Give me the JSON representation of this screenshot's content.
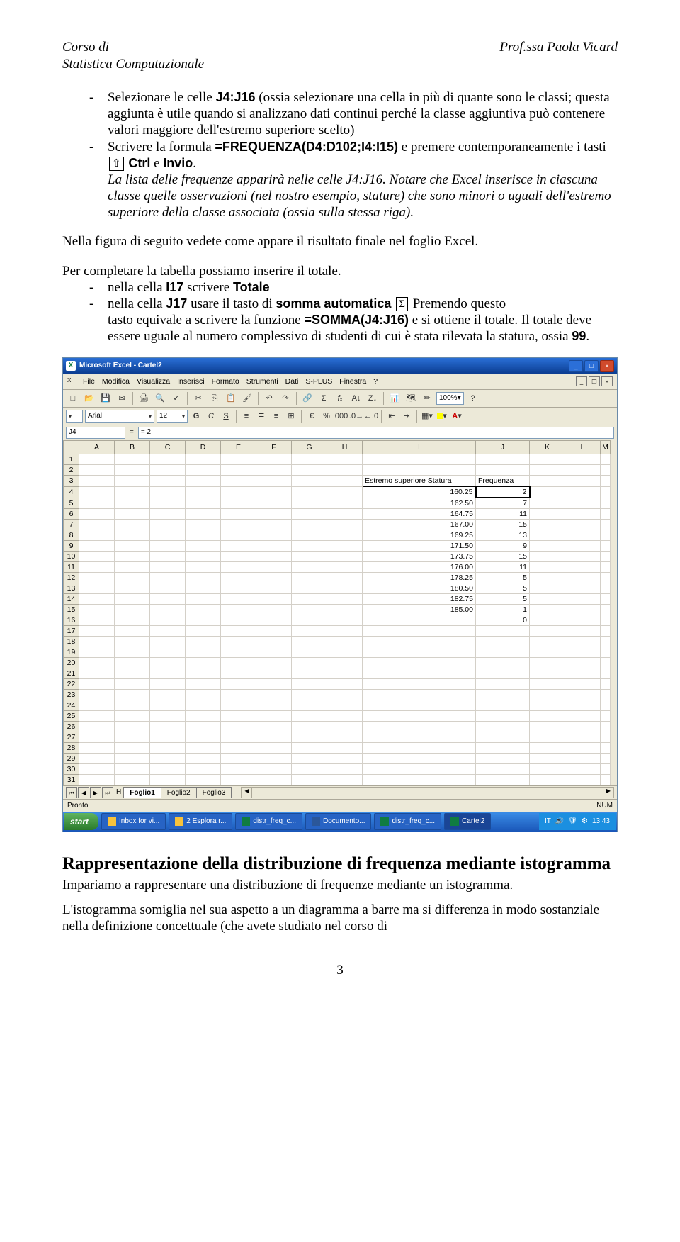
{
  "header": {
    "left_1": "Corso di",
    "right": "Prof.ssa Paola Vicard",
    "left_2": "Statistica Computazionale"
  },
  "li1_a": "Selezionare le celle ",
  "li1_cells": "J4:J16",
  "li1_b": " (ossia selezionare una cella in più di quante sono le classi; questa aggiunta è utile quando si analizzano dati continui perché la classe aggiuntiva può contenere valori maggiore dell'estremo superiore scelto)",
  "li2_a": "Scrivere la formula ",
  "li2_formula": "=FREQUENZA(D4:D102;I4:I15)",
  "li2_b": " e premere contemporaneamente i tasti ",
  "li2_key": "⇧",
  "li2_c": " ",
  "li2_ctrl": "Ctrl",
  "li2_d": " e ",
  "li2_invio": "Invio",
  "li2_e": ".",
  "li2_it": "La lista delle frequenze apparirà nelle celle J4:J16. Notare che Excel inserisce in ciascuna classe quelle osservazioni (nel nostro esempio, stature) che sono minori o uguali dell'estremo superiore della classe associata (ossia sulla stessa riga).",
  "p1": "Nella figura di seguito vedete come appare il risultato finale nel foglio Excel.",
  "p2": "Per completare la tabella possiamo inserire il totale.",
  "li3_a": "nella cella ",
  "li3_cell": "I17",
  "li3_b": " scrivere ",
  "li3_tot": "Totale",
  "li4_a": "nella cella ",
  "li4_cell": "J17",
  "li4_b": " usare il tasto di ",
  "li4_somma": "somma automatica",
  "li4_sigma": "Σ",
  "li4_c": "  Premendo questo",
  "nested_a": "tasto equivale a scrivere la funzione ",
  "nested_formula": "=SOMMA(J4:J16)",
  "nested_b": " e si ottiene il totale. Il totale deve essere uguale al numero complessivo di studenti di cui è stata rilevata la statura, ossia ",
  "nested_99": "99",
  "nested_c": ".",
  "excel": {
    "title": "Microsoft Excel - Cartel2",
    "menus": [
      "File",
      "Modifica",
      "Visualizza",
      "Inserisci",
      "Formato",
      "Strumenti",
      "Dati",
      "S-PLUS",
      "Finestra",
      "?"
    ],
    "zoom": "100%",
    "font": "Arial",
    "fontsize": "12",
    "namebox": "J4",
    "fx_val": "= 2",
    "cols": [
      "",
      "A",
      "B",
      "C",
      "D",
      "E",
      "F",
      "G",
      "H",
      "I",
      "J",
      "K",
      "L",
      "M"
    ],
    "header_I": "Estremo superiore Statura",
    "header_J": "Frequenza",
    "rows": [
      {
        "n": "1"
      },
      {
        "n": "2"
      },
      {
        "n": "3",
        "I": "Estremo superiore Statura",
        "J": "Frequenza",
        "hdr": true
      },
      {
        "n": "4",
        "I": "160.25",
        "J": "2",
        "sel": true
      },
      {
        "n": "5",
        "I": "162.50",
        "J": "7"
      },
      {
        "n": "6",
        "I": "164.75",
        "J": "11"
      },
      {
        "n": "7",
        "I": "167.00",
        "J": "15"
      },
      {
        "n": "8",
        "I": "169.25",
        "J": "13"
      },
      {
        "n": "9",
        "I": "171.50",
        "J": "9"
      },
      {
        "n": "10",
        "I": "173.75",
        "J": "15"
      },
      {
        "n": "11",
        "I": "176.00",
        "J": "11"
      },
      {
        "n": "12",
        "I": "178.25",
        "J": "5"
      },
      {
        "n": "13",
        "I": "180.50",
        "J": "5"
      },
      {
        "n": "14",
        "I": "182.75",
        "J": "5"
      },
      {
        "n": "15",
        "I": "185.00",
        "J": "1"
      },
      {
        "n": "16",
        "I": "",
        "J": "0"
      },
      {
        "n": "17"
      },
      {
        "n": "18",
        "gap": true
      },
      {
        "n": "19"
      },
      {
        "n": "20"
      },
      {
        "n": "21"
      },
      {
        "n": "22"
      },
      {
        "n": "23"
      },
      {
        "n": "24"
      },
      {
        "n": "25"
      },
      {
        "n": "26"
      },
      {
        "n": "27"
      },
      {
        "n": "28"
      },
      {
        "n": "29"
      },
      {
        "n": "30"
      },
      {
        "n": "31"
      }
    ],
    "sheets_prefix": "H",
    "sheets": [
      "Foglio1",
      "Foglio2",
      "Foglio3"
    ],
    "status": "Pronto",
    "num": "NUM"
  },
  "task": {
    "start": "start",
    "btns": [
      "Inbox for vi...",
      "2 Esplora r...",
      "distr_freq_c...",
      "Documento...",
      "distr_freq_c...",
      "Cartel2"
    ],
    "lang": "IT",
    "clock": "13.43"
  },
  "h2_a": "Rappresentazione della distribuzione di frequenza mediante istogramma",
  "p3": "Impariamo a rappresentare una distribuzione di frequenze mediante un istogramma.",
  "p4": "L'istogramma somiglia nel sua aspetto a un diagramma a barre ma si differenza in modo sostanziale nella definizione concettuale (che avete studiato nel corso di",
  "pagenum": "3"
}
